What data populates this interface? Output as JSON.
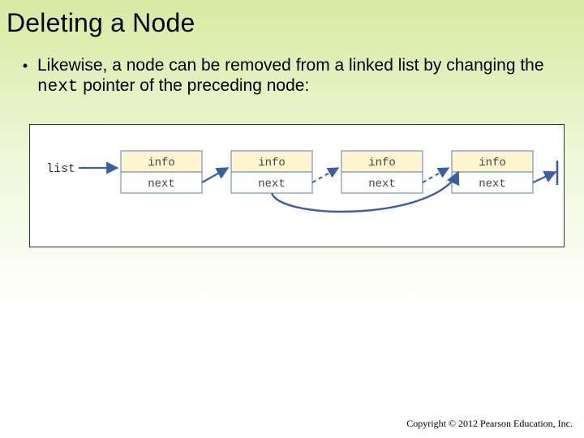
{
  "title": "Deleting a Node",
  "bullet": {
    "pre": "Likewise, a node can be removed from a linked list by changing the ",
    "code": "next",
    "post": " pointer of the preceding node:"
  },
  "diagram": {
    "list_label": "list",
    "node_top": "info",
    "node_bottom": "next",
    "colors": {
      "node_top_fill": "#fef6cf",
      "node_bottom_fill": "#ffffff",
      "node_stroke": "#7a91c6",
      "arrow": "#3b5ea8",
      "skip_dash": "#3b5ea8"
    }
  },
  "copyright": "Copyright © 2012 Pearson Education, Inc."
}
